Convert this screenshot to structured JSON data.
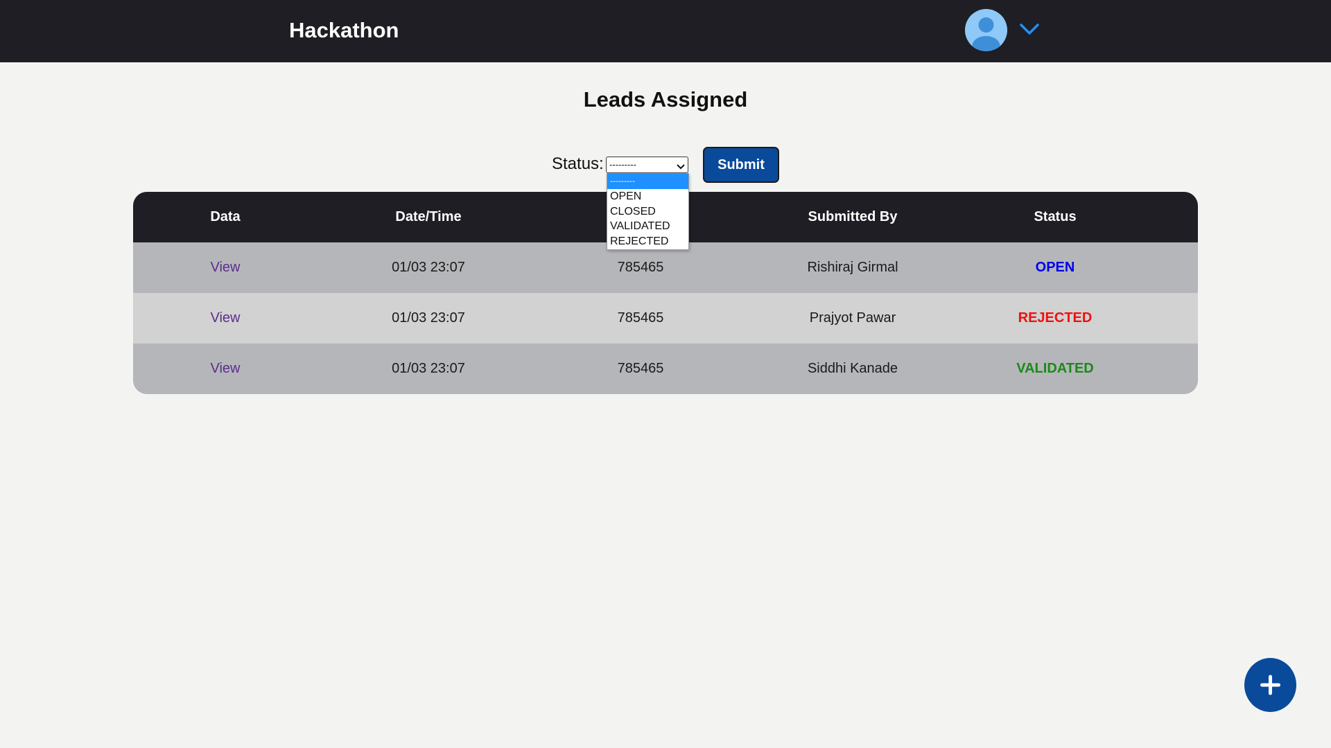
{
  "header": {
    "brand": "Hackathon",
    "avatar_icon": "user-avatar-icon",
    "menu_icon": "chevron-down-icon",
    "accent_color": "#1e90ff"
  },
  "page": {
    "title": "Leads Assigned"
  },
  "filter": {
    "label": "Status:",
    "selected_value": "---------",
    "options": [
      "---------",
      "OPEN",
      "CLOSED",
      "VALIDATED",
      "REJECTED"
    ],
    "submit_label": "Submit",
    "submit_color": "#0a4a9a"
  },
  "table": {
    "columns": [
      "Data",
      "Date/Time",
      "",
      "Submitted By",
      "Status"
    ],
    "rows": [
      {
        "data": "View",
        "datetime": "01/03 23:07",
        "value": "785465",
        "submitted_by": "Rishiraj Girmal",
        "status": "OPEN",
        "status_color": "#0000ee"
      },
      {
        "data": "View",
        "datetime": "01/03 23:07",
        "value": "785465",
        "submitted_by": "Prajyot Pawar",
        "status": "REJECTED",
        "status_color": "#ee1111"
      },
      {
        "data": "View",
        "datetime": "01/03 23:07",
        "value": "785465",
        "submitted_by": "Siddhi Kanade",
        "status": "VALIDATED",
        "status_color": "#1a8a1a"
      }
    ]
  },
  "fab": {
    "icon": "plus-icon",
    "color": "#0a4a9a"
  }
}
